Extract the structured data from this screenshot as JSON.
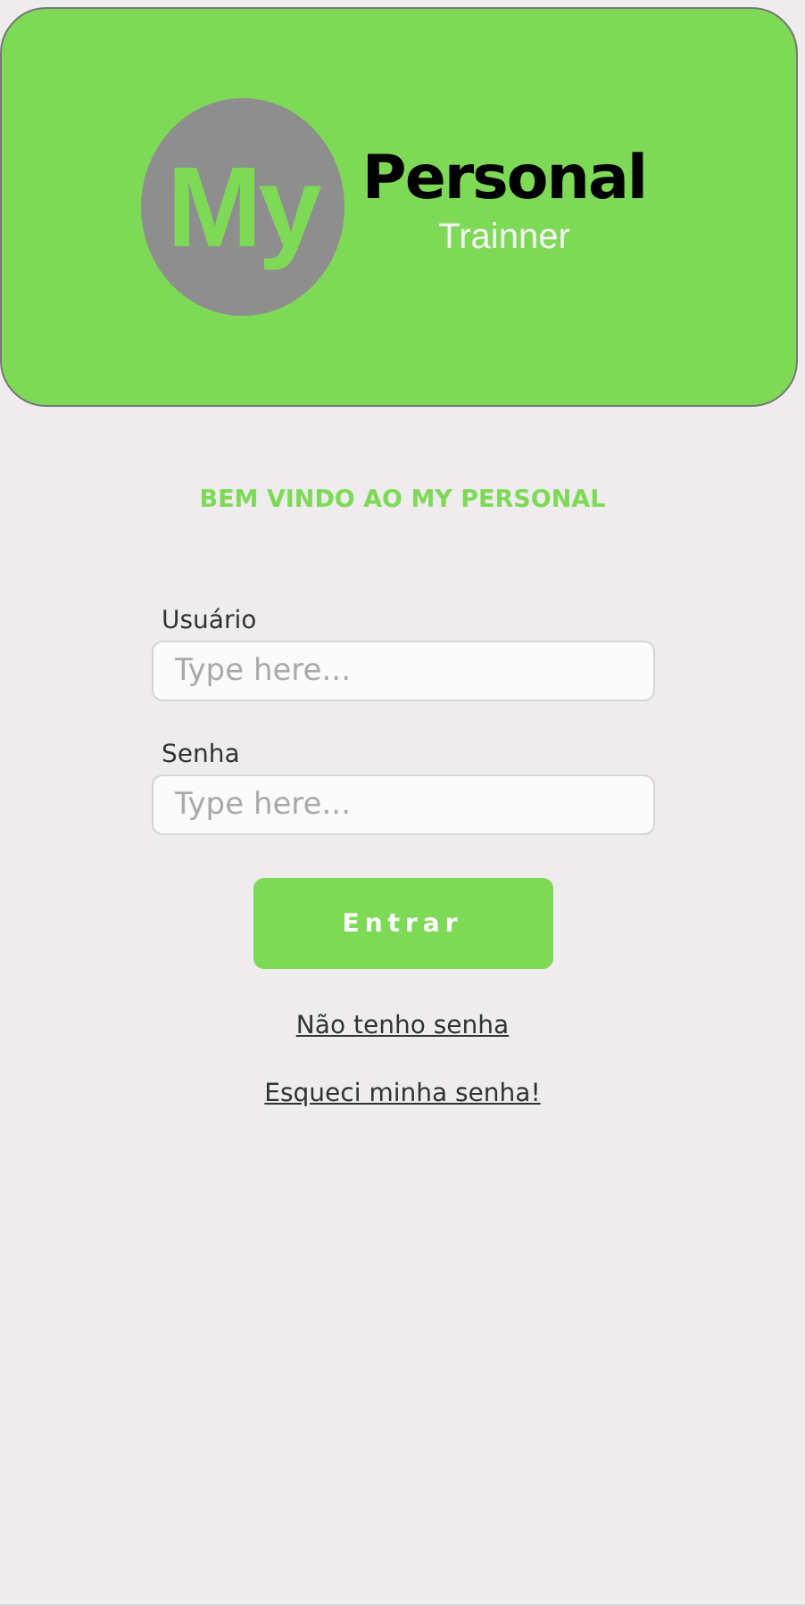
{
  "header": {
    "logo": {
      "mark": "My",
      "title": "Personal",
      "subtitle": "Trainner"
    }
  },
  "welcome": "BEM VINDO AO MY PERSONAL",
  "fields": [
    {
      "label": "Usuário",
      "placeholder": "Type here..."
    },
    {
      "label": "Senha",
      "placeholder": "Type here..."
    }
  ],
  "button": "Entrar",
  "links": [
    "Não tenho senha",
    "Esqueci minha senha!"
  ]
}
